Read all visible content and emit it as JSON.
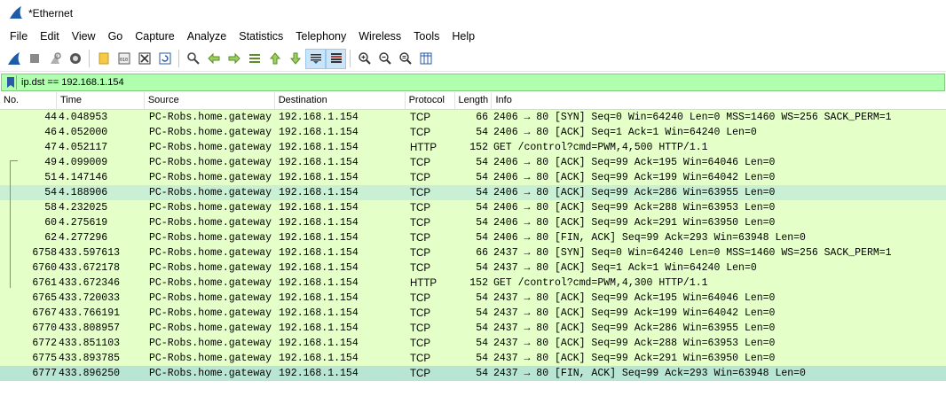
{
  "window": {
    "title": "*Ethernet"
  },
  "menu": [
    "File",
    "Edit",
    "View",
    "Go",
    "Capture",
    "Analyze",
    "Statistics",
    "Telephony",
    "Wireless",
    "Tools",
    "Help"
  ],
  "toolbar": {
    "icons": [
      "shark-fin-start-icon",
      "stop-capture-icon",
      "restart-capture-icon",
      "capture-options-icon",
      "open-file-icon",
      "save-file-icon",
      "close-file-icon",
      "reload-file-icon",
      "find-packet-icon",
      "go-back-icon",
      "go-forward-icon",
      "go-to-packet-icon",
      "go-first-icon",
      "go-last-icon",
      "autoscroll-icon",
      "colorize-icon",
      "zoom-in-icon",
      "zoom-out-icon",
      "normal-size-icon",
      "resize-columns-icon"
    ]
  },
  "filter": {
    "value": "ip.dst == 192.168.1.154"
  },
  "columns": {
    "no": "No.",
    "time": "Time",
    "source": "Source",
    "destination": "Destination",
    "protocol": "Protocol",
    "length": "Length",
    "info": "Info"
  },
  "packets": [
    {
      "no": "44",
      "time": "4.048953",
      "source": "PC-Robs.home.gateway",
      "destination": "192.168.1.154",
      "protocol": "TCP",
      "length": "66",
      "info": "2406 → 80 [SYN] Seq=0 Win=64240 Len=0 MSS=1460 WS=256 SACK_PERM=1"
    },
    {
      "no": "46",
      "time": "4.052000",
      "source": "PC-Robs.home.gateway",
      "destination": "192.168.1.154",
      "protocol": "TCP",
      "length": "54",
      "info": "2406 → 80 [ACK] Seq=1 Ack=1 Win=64240 Len=0"
    },
    {
      "no": "47",
      "time": "4.052117",
      "source": "PC-Robs.home.gateway",
      "destination": "192.168.1.154",
      "protocol": "HTTP",
      "length": "152",
      "info": "GET /control?cmd=PWM,4,500 HTTP/1.1"
    },
    {
      "no": "49",
      "time": "4.099009",
      "source": "PC-Robs.home.gateway",
      "destination": "192.168.1.154",
      "protocol": "TCP",
      "length": "54",
      "info": "2406 → 80 [ACK] Seq=99 Ack=195 Win=64046 Len=0"
    },
    {
      "no": "51",
      "time": "4.147146",
      "source": "PC-Robs.home.gateway",
      "destination": "192.168.1.154",
      "protocol": "TCP",
      "length": "54",
      "info": "2406 → 80 [ACK] Seq=99 Ack=199 Win=64042 Len=0"
    },
    {
      "no": "54",
      "time": "4.188906",
      "source": "PC-Robs.home.gateway",
      "destination": "192.168.1.154",
      "protocol": "TCP",
      "length": "54",
      "info": "2406 → 80 [ACK] Seq=99 Ack=286 Win=63955 Len=0"
    },
    {
      "no": "58",
      "time": "4.232025",
      "source": "PC-Robs.home.gateway",
      "destination": "192.168.1.154",
      "protocol": "TCP",
      "length": "54",
      "info": "2406 → 80 [ACK] Seq=99 Ack=288 Win=63953 Len=0"
    },
    {
      "no": "60",
      "time": "4.275619",
      "source": "PC-Robs.home.gateway",
      "destination": "192.168.1.154",
      "protocol": "TCP",
      "length": "54",
      "info": "2406 → 80 [ACK] Seq=99 Ack=291 Win=63950 Len=0"
    },
    {
      "no": "62",
      "time": "4.277296",
      "source": "PC-Robs.home.gateway",
      "destination": "192.168.1.154",
      "protocol": "TCP",
      "length": "54",
      "info": "2406 → 80 [FIN, ACK] Seq=99 Ack=293 Win=63948 Len=0"
    },
    {
      "no": "6758",
      "time": "433.597613",
      "source": "PC-Robs.home.gateway",
      "destination": "192.168.1.154",
      "protocol": "TCP",
      "length": "66",
      "info": "2437 → 80 [SYN] Seq=0 Win=64240 Len=0 MSS=1460 WS=256 SACK_PERM=1"
    },
    {
      "no": "6760",
      "time": "433.672178",
      "source": "PC-Robs.home.gateway",
      "destination": "192.168.1.154",
      "protocol": "TCP",
      "length": "54",
      "info": "2437 → 80 [ACK] Seq=1 Ack=1 Win=64240 Len=0"
    },
    {
      "no": "6761",
      "time": "433.672346",
      "source": "PC-Robs.home.gateway",
      "destination": "192.168.1.154",
      "protocol": "HTTP",
      "length": "152",
      "info": "GET /control?cmd=PWM,4,300 HTTP/1.1"
    },
    {
      "no": "6765",
      "time": "433.720033",
      "source": "PC-Robs.home.gateway",
      "destination": "192.168.1.154",
      "protocol": "TCP",
      "length": "54",
      "info": "2437 → 80 [ACK] Seq=99 Ack=195 Win=64046 Len=0"
    },
    {
      "no": "6767",
      "time": "433.766191",
      "source": "PC-Robs.home.gateway",
      "destination": "192.168.1.154",
      "protocol": "TCP",
      "length": "54",
      "info": "2437 → 80 [ACK] Seq=99 Ack=199 Win=64042 Len=0"
    },
    {
      "no": "6770",
      "time": "433.808957",
      "source": "PC-Robs.home.gateway",
      "destination": "192.168.1.154",
      "protocol": "TCP",
      "length": "54",
      "info": "2437 → 80 [ACK] Seq=99 Ack=286 Win=63955 Len=0"
    },
    {
      "no": "6772",
      "time": "433.851103",
      "source": "PC-Robs.home.gateway",
      "destination": "192.168.1.154",
      "protocol": "TCP",
      "length": "54",
      "info": "2437 → 80 [ACK] Seq=99 Ack=288 Win=63953 Len=0"
    },
    {
      "no": "6775",
      "time": "433.893785",
      "source": "PC-Robs.home.gateway",
      "destination": "192.168.1.154",
      "protocol": "TCP",
      "length": "54",
      "info": "2437 → 80 [ACK] Seq=99 Ack=291 Win=63950 Len=0"
    },
    {
      "no": "6777",
      "time": "433.896250",
      "source": "PC-Robs.home.gateway",
      "destination": "192.168.1.154",
      "protocol": "TCP",
      "length": "54",
      "info": "2437 → 80 [FIN, ACK] Seq=99 Ack=293 Win=63948 Len=0"
    }
  ],
  "colors": {
    "tcp_row": "#e4ffc7",
    "highlight_row": "#c9f0d5",
    "selected_row": "#b9e6d2",
    "filter_valid": "#afffaf"
  }
}
